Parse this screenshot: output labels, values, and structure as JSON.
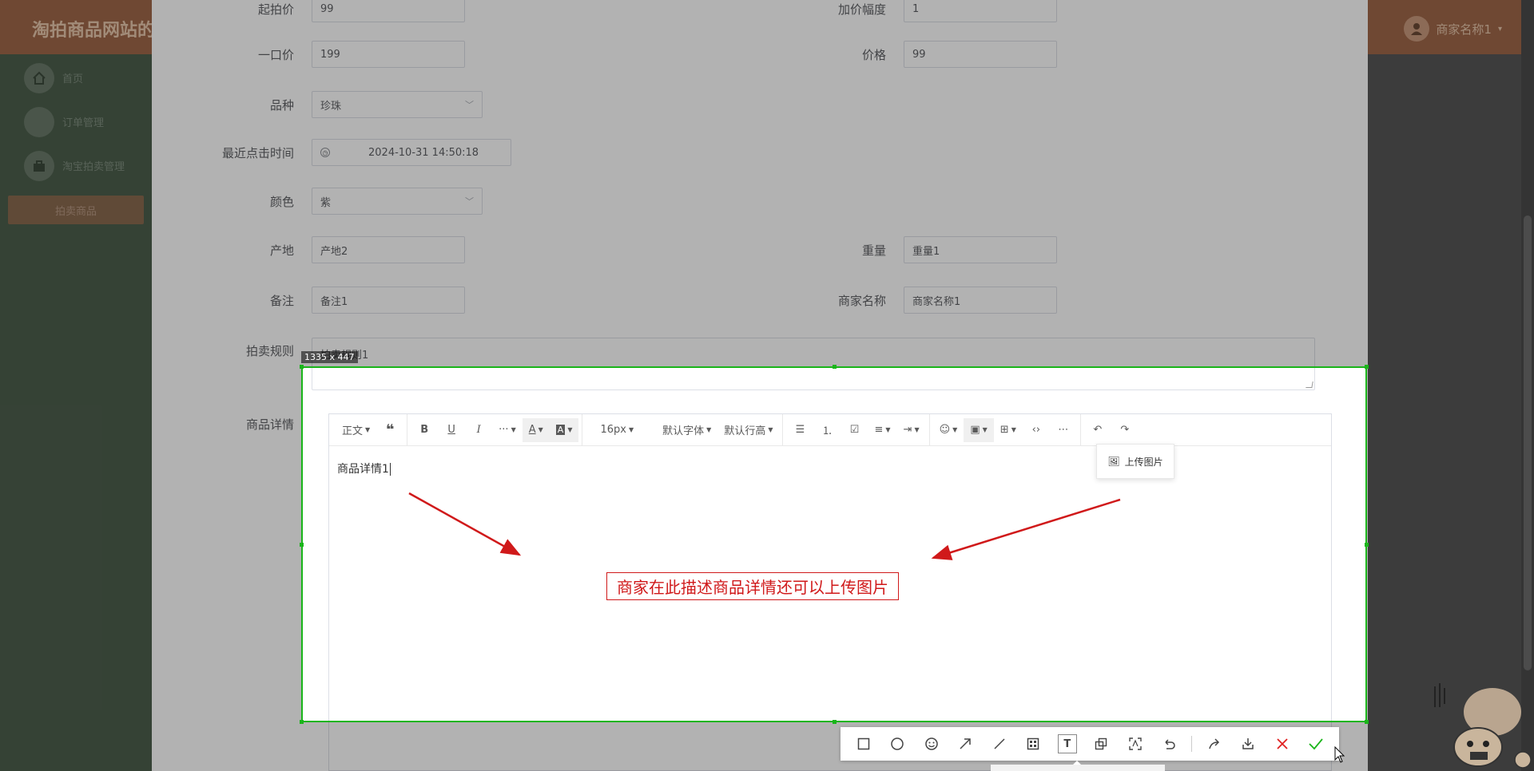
{
  "app": {
    "title": "淘拍商品网站的",
    "user_name": "商家名称1",
    "sidebar": [
      {
        "label": "首页",
        "icon": "home-icon"
      },
      {
        "label": "订单管理",
        "icon": "order-icon"
      },
      {
        "label": "淘宝拍卖管理",
        "icon": "briefcase-icon"
      }
    ],
    "sidebar_active": "拍卖商品"
  },
  "form": {
    "start_price": {
      "label": "起拍价",
      "value": "99"
    },
    "increment": {
      "label": "加价幅度",
      "value": "1"
    },
    "buyout_price": {
      "label": "一口价",
      "value": "199"
    },
    "price": {
      "label": "价格",
      "value": "99"
    },
    "variety": {
      "label": "品种",
      "value": "珍珠"
    },
    "last_click": {
      "label": "最近点击时间",
      "value": "2024-10-31 14:50:18"
    },
    "color": {
      "label": "颜色",
      "value": "紫"
    },
    "origin": {
      "label": "产地",
      "value": "产地2"
    },
    "weight": {
      "label": "重量",
      "value": "重量1"
    },
    "remark": {
      "label": "备注",
      "value": "备注1"
    },
    "merchant": {
      "label": "商家名称",
      "value": "商家名称1"
    },
    "rules": {
      "label": "拍卖规则",
      "value": "拍卖规则1"
    },
    "details": {
      "label": "商品详情",
      "value": "商品详情1"
    }
  },
  "editor_toolbar": {
    "paragraph": "正文",
    "font_size": "16px",
    "font_family": "默认字体",
    "line_height": "默认行高",
    "upload_image": "上传图片"
  },
  "annotation": {
    "text": "商家在此描述商品详情还可以上传图片",
    "color": "#d0191a"
  },
  "capture": {
    "size_label": "1335 x 447",
    "border_color": "#1ab51a"
  }
}
